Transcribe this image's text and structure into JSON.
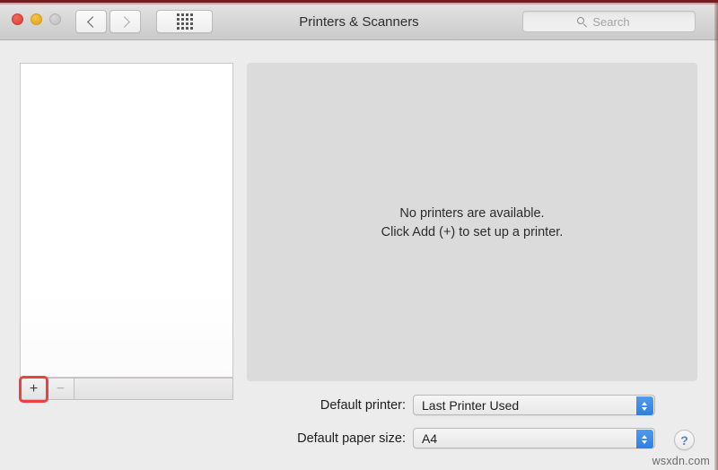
{
  "window": {
    "title": "Printers & Scanners",
    "traffic_lights": [
      {
        "name": "close",
        "color": "#e04a3f",
        "state": "enabled"
      },
      {
        "name": "minimize",
        "color": "#e9ab22",
        "state": "enabled"
      },
      {
        "name": "zoom",
        "color": "#c6c4c4",
        "state": "disabled"
      }
    ]
  },
  "toolbar": {
    "back_icon": "chevron-left-icon",
    "forward_icon": "chevron-right-icon",
    "show_all_icon": "grid-dots-icon",
    "search": {
      "icon": "search-icon",
      "placeholder": "Search",
      "value": ""
    }
  },
  "printer_list": {
    "items": [],
    "add_button_label": "+",
    "remove_button_label": "−",
    "add_button_highlighted": true,
    "highlight_color": "#ef4040"
  },
  "detail": {
    "line1": "No printers are available.",
    "line2": "Click Add (+) to set up a printer."
  },
  "settings": {
    "default_printer": {
      "label": "Default printer:",
      "value": "Last Printer Used",
      "options": [
        "Last Printer Used"
      ]
    },
    "default_paper_size": {
      "label": "Default paper size:",
      "value": "A4",
      "options": [
        "A4"
      ]
    }
  },
  "help": {
    "icon": "question-mark-icon",
    "label": "?"
  },
  "watermark": {
    "text": "wsxdn.com"
  }
}
